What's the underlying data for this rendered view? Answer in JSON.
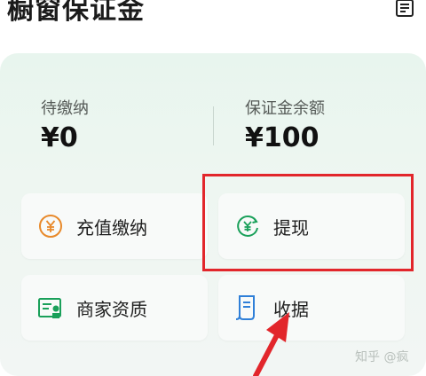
{
  "header": {
    "title": "橱窗保证金",
    "menu_icon": "document-list-icon"
  },
  "stats": {
    "pending": {
      "label": "待缴纳",
      "value": "¥0"
    },
    "balance": {
      "label": "保证金余额",
      "value": "¥100"
    }
  },
  "actions": [
    {
      "label": "充值缴纳",
      "icon": "yen-coin-icon",
      "color": "#e8892a"
    },
    {
      "label": "提现",
      "icon": "withdraw-yen-icon",
      "color": "#1aa05a"
    },
    {
      "label": "商家资质",
      "icon": "qualification-card-icon",
      "color": "#1aa05a"
    },
    {
      "label": "收据",
      "icon": "receipt-icon",
      "color": "#2f7fd8"
    }
  ],
  "annotation": {
    "highlight_color": "#e2262b"
  },
  "watermark": "知乎 @疯"
}
